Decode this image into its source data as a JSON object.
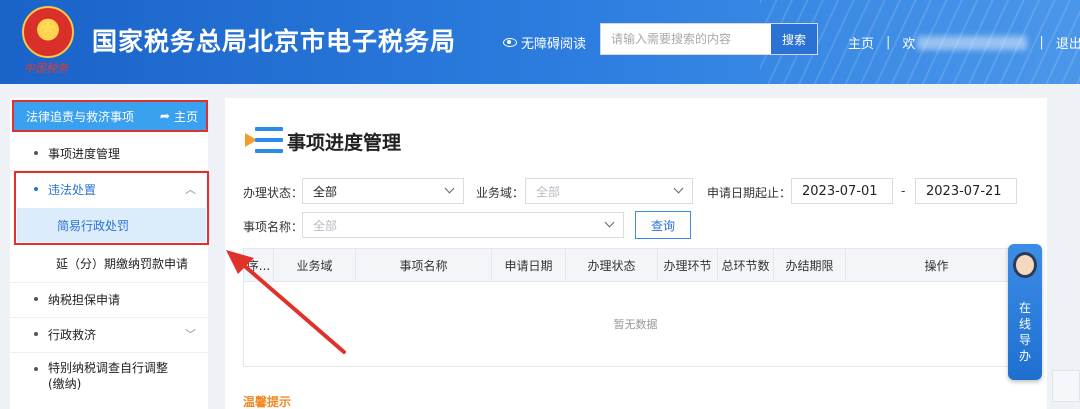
{
  "header": {
    "logo_script": "中国税务",
    "title": "国家税务总局北京市电子税务局",
    "a11y_label": "无障碍阅读",
    "search_placeholder": "请输入需要搜索的内容",
    "search_button": "搜索",
    "nav_home": "主页",
    "nav_user_prefix": "欢",
    "nav_logout": "退出"
  },
  "sidebar": {
    "section_title": "法律追责与救济事项",
    "home_label": "主页",
    "items": [
      {
        "label": "事项进度管理"
      },
      {
        "label": "违法处置"
      },
      {
        "label": "简易行政处罚"
      },
      {
        "label": "延（分）期缴纳罚款申请"
      },
      {
        "label": "纳税担保申请"
      },
      {
        "label": "行政救济"
      },
      {
        "label": "特别纳税调查自行调整(缴纳)"
      }
    ]
  },
  "main": {
    "page_title": "事项进度管理",
    "filters": {
      "status_label": "办理状态：",
      "status_value": "全部",
      "domain_label": "业务域：",
      "domain_placeholder": "全部",
      "date_label": "申请日期起止：",
      "date_start": "2023-07-01",
      "date_sep": "-",
      "date_end": "2023-07-21",
      "name_label": "事项名称：",
      "name_placeholder": "全部",
      "query_button": "查询"
    },
    "table": {
      "columns": [
        "序...",
        "业务域",
        "事项名称",
        "申请日期",
        "办理状态",
        "办理环节",
        "总环节数",
        "办结期限",
        "操作"
      ],
      "empty_text": "暂无数据"
    },
    "tips_title": "温馨提示"
  },
  "guide": {
    "label_1": "在",
    "label_2": "线",
    "label_3": "导",
    "label_4": "办"
  },
  "colors": {
    "header_blue": "#1a63c8",
    "sidebar_head": "#3aa0f0",
    "highlight_red": "#e0322a",
    "active_link": "#2a72d4",
    "tips_orange": "#f08a24"
  }
}
